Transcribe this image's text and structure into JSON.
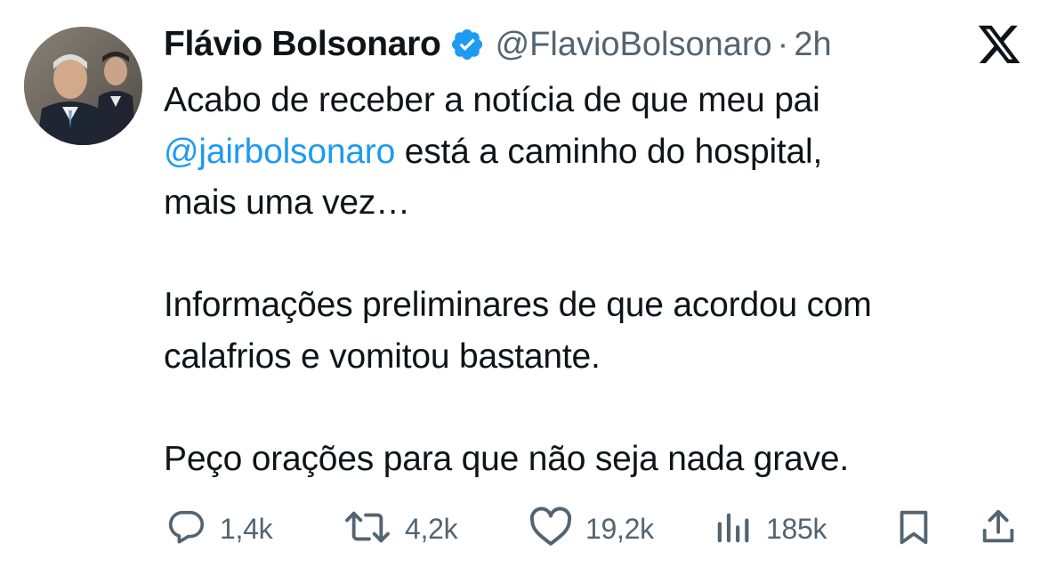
{
  "author": {
    "display_name": "Flávio Bolsonaro",
    "handle": "@FlavioBolsonaro",
    "separator": "·",
    "timestamp": "2h",
    "verified": true
  },
  "tweet": {
    "lines_paragraph1": [
      "Acabo de receber a notícia de que meu pai",
      "está a caminho do hospital,",
      "mais uma vez…"
    ],
    "mention": "@jairbolsonaro",
    "paragraph2": [
      "Informações preliminares de que acordou com",
      "calafrios e vomitou bastante."
    ],
    "paragraph3": "Peço orações para que não seja nada grave."
  },
  "actions": {
    "replies": "1,4k",
    "reposts": "4,2k",
    "likes": "19,2k",
    "views": "185k"
  },
  "icons": {
    "brand": "x-logo-icon",
    "verified": "verified-badge-icon",
    "reply": "reply-icon",
    "repost": "repost-icon",
    "like": "heart-icon",
    "views": "views-icon",
    "bookmark": "bookmark-icon",
    "share": "share-icon"
  },
  "colors": {
    "text": "#0f1419",
    "secondary": "#536471",
    "accent": "#1d9bf0"
  }
}
